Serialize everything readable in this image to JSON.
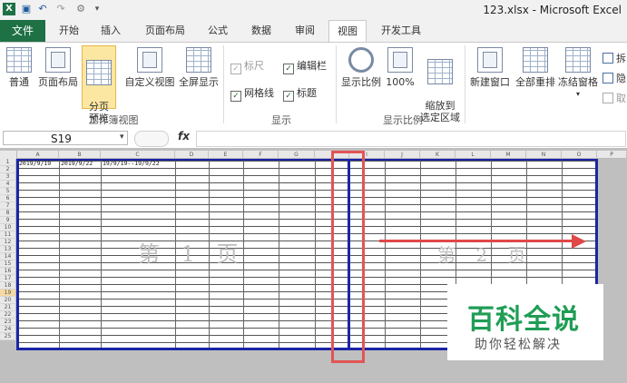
{
  "title": "123.xlsx - Microsoft Excel",
  "app_icon": "X",
  "quick_access": [
    "save-icon",
    "undo-icon",
    "redo-icon",
    "customize-icon"
  ],
  "tabs": [
    "文件",
    "开始",
    "插入",
    "页面布局",
    "公式",
    "数据",
    "审阅",
    "视图",
    "开发工具"
  ],
  "active_tab": "视图",
  "ribbon": {
    "workbook_views": {
      "label": "工作簿视图",
      "buttons": [
        "普通",
        "页面布局",
        "分页\n预览",
        "自定义视图",
        "全屏显示"
      ],
      "pressed": "分页预览"
    },
    "show": {
      "label": "显示",
      "checkboxes": [
        {
          "text": "标尺",
          "checked": true,
          "disabled": true
        },
        {
          "text": "编辑栏",
          "checked": true,
          "disabled": false
        },
        {
          "text": "网格线",
          "checked": true,
          "disabled": false
        },
        {
          "text": "标题",
          "checked": true,
          "disabled": false
        }
      ]
    },
    "zoom": {
      "label": "显示比例",
      "buttons": [
        "显示比例",
        "100%",
        "缩放到\n选定区域"
      ]
    },
    "window": {
      "buttons": [
        "新建窗口",
        "全部重排",
        "冻结窗格"
      ],
      "small": [
        "拆",
        "隐",
        "取"
      ]
    }
  },
  "namebox": "S19",
  "fx": "fx",
  "columns": [
    "A",
    "B",
    "C",
    "D",
    "E",
    "F",
    "G",
    "",
    "I",
    "J",
    "K",
    "L",
    "M",
    "N",
    "O",
    "P"
  ],
  "rows": [
    "1",
    "2",
    "3",
    "4",
    "5",
    "6",
    "7",
    "8",
    "9",
    "10",
    "11",
    "12",
    "13",
    "14",
    "15",
    "16",
    "17",
    "18",
    "19",
    "20",
    "21",
    "22",
    "23",
    "24",
    "25"
  ],
  "selected_row": "19",
  "cells": {
    "A1": "2019/9/19",
    "B1": "2019/9/22",
    "C1": "19/9/19--19/9/22"
  },
  "watermarks": {
    "page1": "第 1 页",
    "page2": "第 2 页"
  },
  "logo": {
    "main": "百科全说",
    "sub": "助你轻松解决"
  },
  "colors": {
    "excel_green": "#1e7145",
    "page_break": "#1a25a6",
    "highlight_red": "#e25555",
    "logo_green": "#1f9d55"
  }
}
